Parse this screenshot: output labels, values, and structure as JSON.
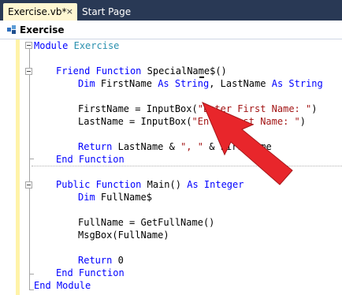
{
  "tabs": [
    {
      "label": "Exercise.vb*",
      "close": "×"
    },
    {
      "label": "Start Page"
    }
  ],
  "navbar": {
    "label": "Exercise"
  },
  "code": {
    "l1": {
      "kw": "Module",
      "name": "Exercise"
    },
    "l2": {
      "kw1": "Friend",
      "kw2": "Function",
      "name": "SpecialName$()"
    },
    "l3": {
      "kw1": "Dim",
      "a": "FirstName",
      "kw2": "As",
      "ty1": "String",
      "b": ", LastName",
      "kw3": "As",
      "ty2": "String"
    },
    "l4": {
      "a": "FirstName = InputBox(",
      "st": "\"Enter First Name: \"",
      "b": ")"
    },
    "l5": {
      "a": "LastName = InputBox(",
      "st": "\"Enter Last Name: \"",
      "b": ")"
    },
    "l6": {
      "kw": "Return",
      "a": "LastName &",
      "st": "\", \"",
      "b": "& FirstName"
    },
    "l7": {
      "kw": "End Function"
    },
    "l8": {
      "kw1": "Public",
      "kw2": "Function",
      "a": "Main()",
      "kw3": "As",
      "ty": "Integer"
    },
    "l9": {
      "kw": "Dim",
      "a": "FullName$"
    },
    "l10": {
      "a": "FullName = GetFullName()"
    },
    "l11": {
      "a": "MsgBox(FullName)"
    },
    "l12": {
      "kw": "Return",
      "a": "0"
    },
    "l13": {
      "kw": "End Function"
    },
    "l14": {
      "kw": "End Module"
    }
  },
  "colors": {
    "keyword": "#0000ff",
    "type": "#2b91af",
    "string": "#a31515",
    "arrow": "#e8262b"
  }
}
